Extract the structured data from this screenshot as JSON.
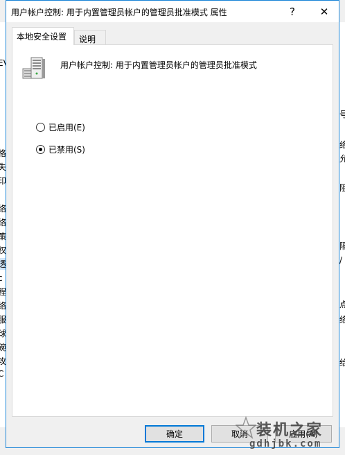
{
  "dialog": {
    "title": "用户帐户控制: 用于内置管理员帐户的管理员批准模式 属性",
    "help_glyph": "?",
    "close_glyph": "✕"
  },
  "tabs": [
    {
      "label": "本地安全设置",
      "active": true
    },
    {
      "label": "说明",
      "active": false
    }
  ],
  "policy": {
    "icon": "server-computer-icon",
    "title": "用户帐户控制: 用于内置管理员帐户的管理员批准模式"
  },
  "options": [
    {
      "label": "已启用(E)",
      "checked": false
    },
    {
      "label": "已禁用(S)",
      "checked": true
    }
  ],
  "buttons": {
    "ok": "确定",
    "cancel": "取消",
    "apply": "应用(A)"
  },
  "watermark": {
    "brand": "装机之家",
    "url": "gdhjbk.com"
  },
  "background_window": {
    "left_chars": [
      "EV",
      "格",
      "失",
      "印",
      "络",
      "络",
      "策",
      "权",
      "透",
      "c",
      "程",
      "络",
      "服",
      "球",
      "碗",
      "攻",
      "C"
    ],
    "right_chars": [
      "号",
      "络",
      "允",
      "阻",
      "隔",
      "/",
      "点",
      "络",
      "给"
    ]
  },
  "colors": {
    "accent": "#0078d7",
    "window_border": "#1883d7",
    "dialog_bg": "#f0f0f0"
  }
}
